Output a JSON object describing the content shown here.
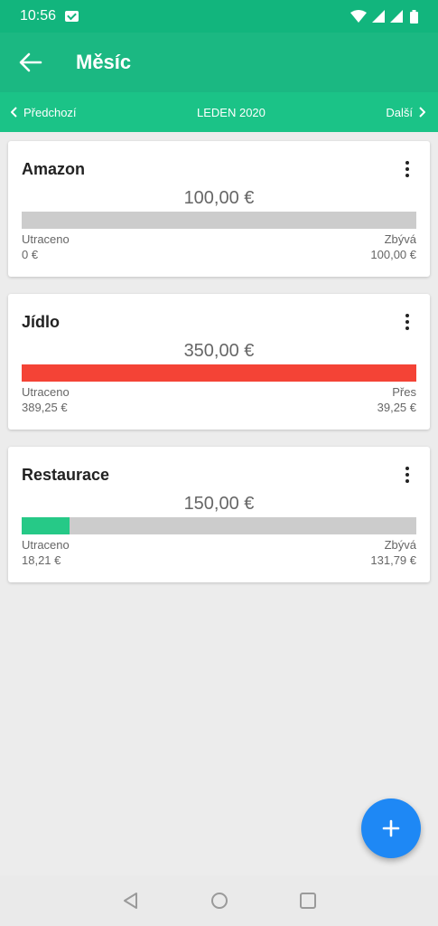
{
  "status": {
    "time": "10:56"
  },
  "appbar": {
    "title": "Měsíc"
  },
  "month": {
    "prev_label": "Předchozí",
    "current": "LEDEN 2020",
    "next_label": "Další"
  },
  "colors": {
    "primary": "#1bb882",
    "over": "#f44336",
    "under": "#26c987",
    "track": "#cccccc",
    "fab": "#1e88f5"
  },
  "budgets": [
    {
      "name": "Amazon",
      "amount": "100,00 €",
      "spent_label": "Utraceno",
      "spent": "0 €",
      "remain_label": "Zbývá",
      "remain": "100,00 €",
      "progress": 0.0,
      "state": "under"
    },
    {
      "name": "Jídlo",
      "amount": "350,00 €",
      "spent_label": "Utraceno",
      "spent": "389,25 €",
      "remain_label": "Přes",
      "remain": "39,25 €",
      "progress": 1.0,
      "state": "over"
    },
    {
      "name": "Restaurace",
      "amount": "150,00 €",
      "spent_label": "Utraceno",
      "spent": "18,21 €",
      "remain_label": "Zbývá",
      "remain": "131,79 €",
      "progress": 0.1214,
      "state": "under"
    }
  ],
  "icons": {
    "back": "arrow-left-icon",
    "more": "more-vert-icon",
    "add": "plus-icon"
  }
}
